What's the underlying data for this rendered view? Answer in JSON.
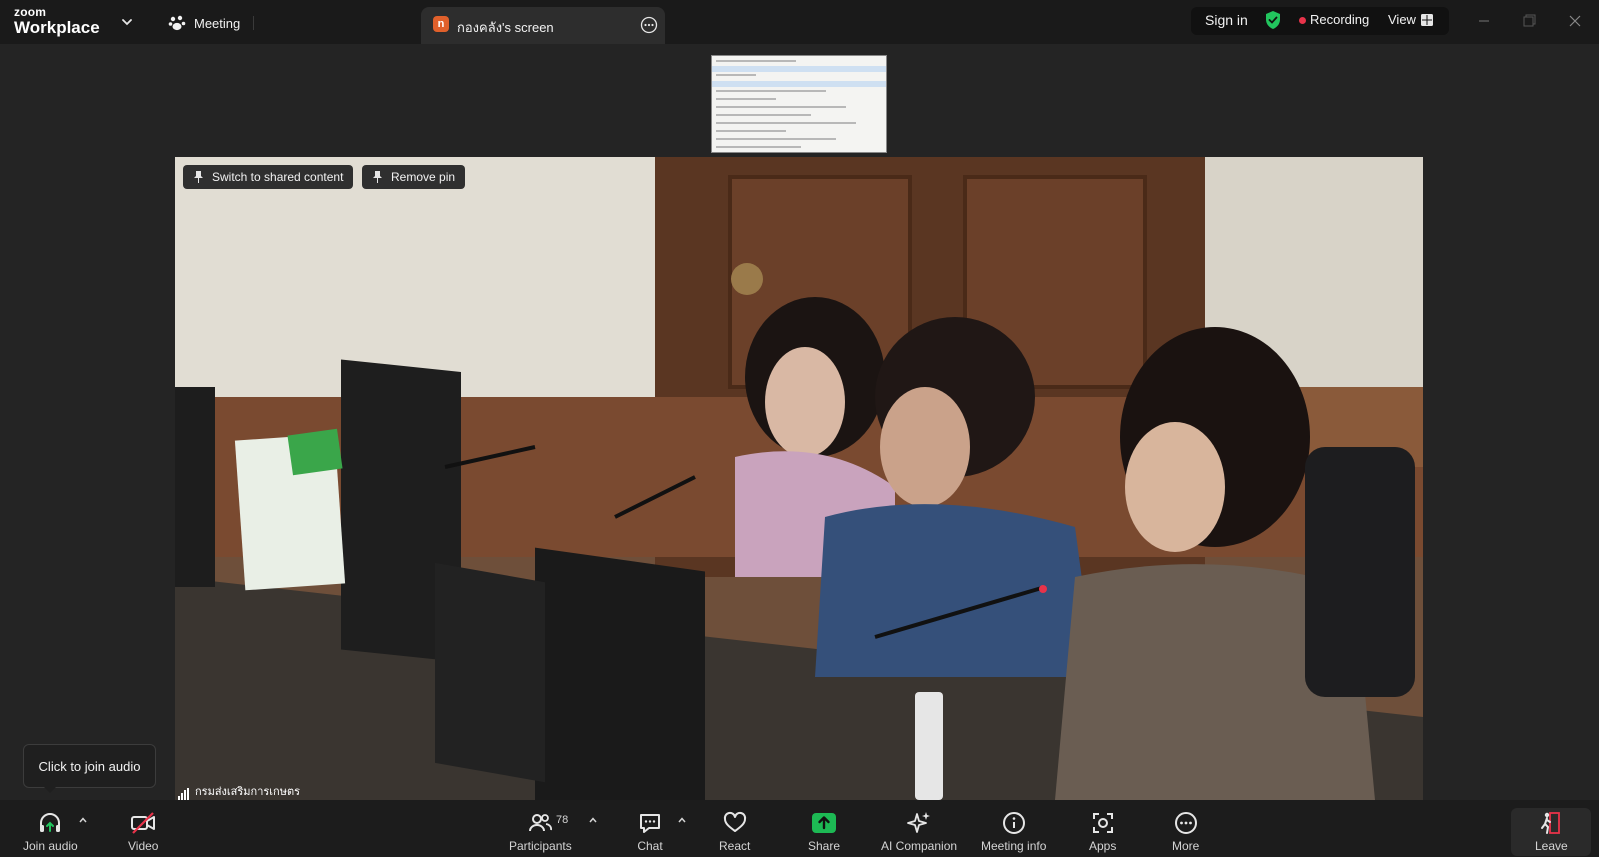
{
  "titlebar": {
    "logo_zoom": "zoom",
    "logo_workplace": "Workplace",
    "meeting_tab": "Meeting",
    "share_tab_badge": "n",
    "share_tab_label": "กองคลัง's screen",
    "signin": "Sign in",
    "recording": "Recording",
    "view": "View"
  },
  "stage": {
    "switch_btn": "Switch to shared content",
    "remove_pin_btn": "Remove pin",
    "participant_name": "กรมส่งเสริมการเกษตร",
    "tooltip": "Click to join audio"
  },
  "toolbar": {
    "join_audio": "Join audio",
    "video": "Video",
    "participants": "Participants",
    "participants_count": "78",
    "chat": "Chat",
    "react": "React",
    "share": "Share",
    "ai_companion": "AI Companion",
    "meeting_info": "Meeting info",
    "apps": "Apps",
    "more": "More",
    "leave": "Leave"
  },
  "colors": {
    "background": "#242424",
    "titlebar": "#1a1a1a",
    "toolbar": "#1c1c1c",
    "share_green": "#1db954",
    "recording_red": "#e8334a",
    "shield_green": "#22c55e",
    "badge_orange": "#e0602b"
  },
  "icons": [
    "chevron-down-icon",
    "paw-icon",
    "more-icon",
    "shield-check-icon",
    "grid-icon",
    "minimize-icon",
    "restore-icon",
    "close-icon",
    "pin-icon",
    "headphones-icon",
    "video-off-icon",
    "participants-icon",
    "chat-icon",
    "heart-icon",
    "share-arrow-icon",
    "sparkle-icon",
    "info-icon",
    "apps-icon",
    "ellipsis-icon",
    "leave-icon"
  ]
}
